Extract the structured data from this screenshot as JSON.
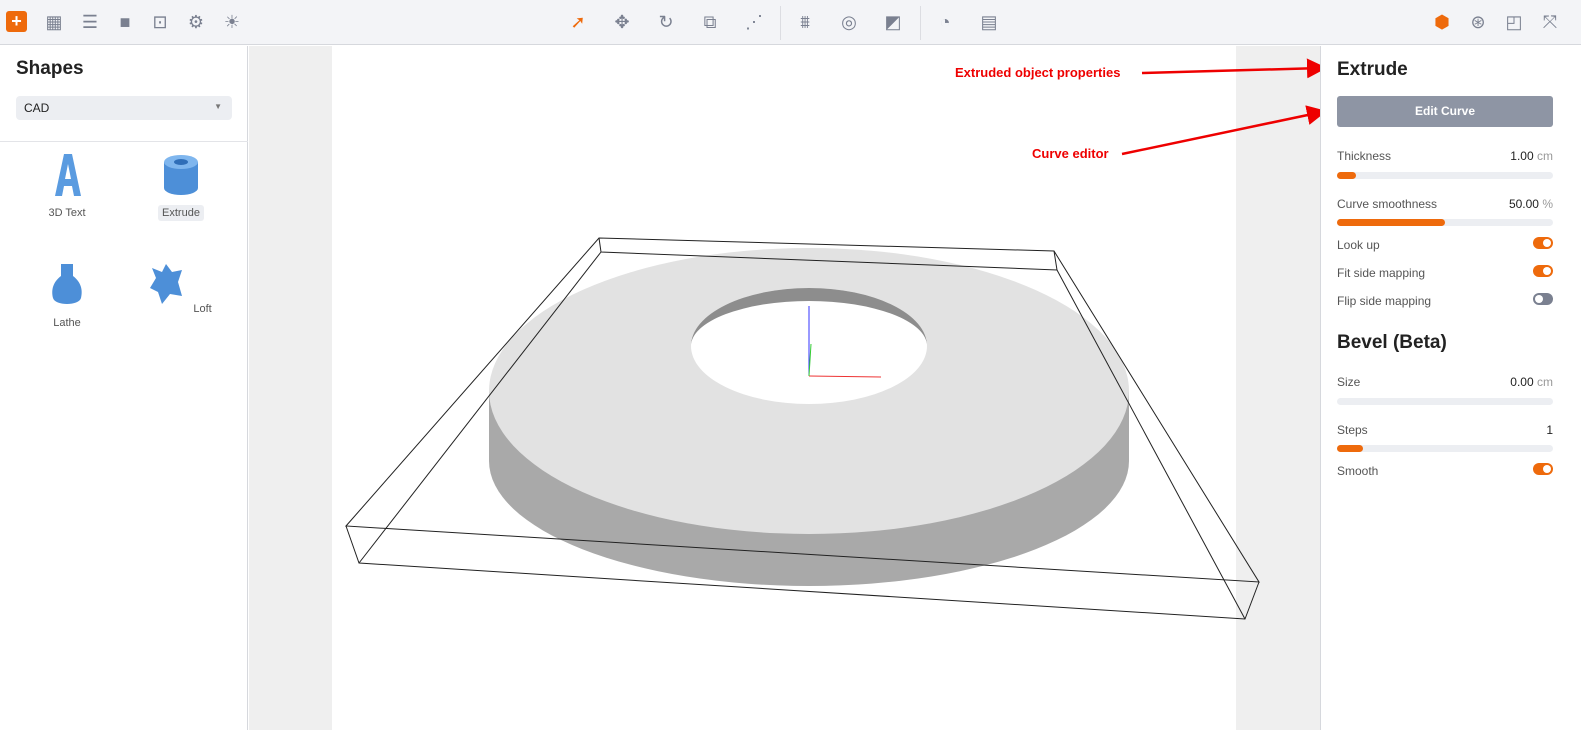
{
  "toolbar": {
    "left_icons": [
      "add-icon",
      "grid-icon",
      "list-icon",
      "camera-icon",
      "focus-icon",
      "gear-icon",
      "light-icon"
    ],
    "center_icons": [
      "select-icon",
      "move-icon",
      "rotate-icon",
      "scale-icon",
      "transform-icon",
      "ground-icon",
      "view-icon",
      "material-icon",
      "time-icon",
      "clapper-icon"
    ],
    "right_icons": [
      "object-icon",
      "texture-icon",
      "panel-icon",
      "fullscreen-icon"
    ],
    "accent": "#ee6a0c"
  },
  "left_panel": {
    "title": "Shapes",
    "category": "CAD",
    "shapes": [
      {
        "label": "3D Text"
      },
      {
        "label": "Extrude"
      },
      {
        "label": "Lathe"
      },
      {
        "label": "Loft"
      }
    ]
  },
  "annotations": {
    "properties": "Extruded object properties",
    "curve": "Curve editor"
  },
  "right_panel": {
    "title": "Extrude",
    "edit_curve": "Edit Curve",
    "thickness": {
      "label": "Thickness",
      "value": "1.00",
      "unit": "cm",
      "fraction": 0.09
    },
    "smoothness": {
      "label": "Curve smoothness",
      "value": "50.00",
      "unit": "%",
      "fraction": 0.5
    },
    "look_up": {
      "label": "Look up",
      "on": true
    },
    "fit_side": {
      "label": "Fit side mapping",
      "on": true
    },
    "flip_side": {
      "label": "Flip side mapping",
      "on": false
    },
    "bevel_title": "Bevel (Beta)",
    "size": {
      "label": "Size",
      "value": "0.00",
      "unit": "cm",
      "fraction": 0
    },
    "steps": {
      "label": "Steps",
      "value": "1",
      "fraction": 0.12
    },
    "smooth": {
      "label": "Smooth",
      "on": true
    }
  }
}
